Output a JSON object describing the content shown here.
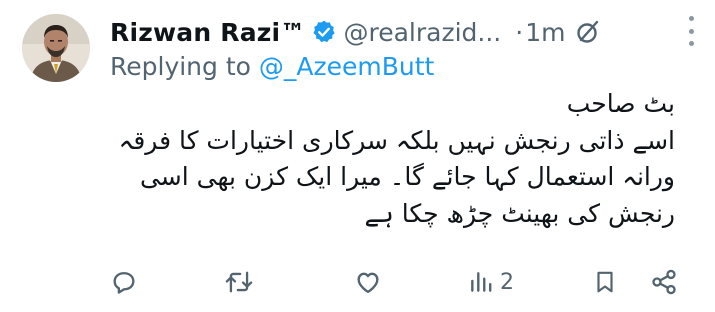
{
  "tweet": {
    "author_name": "Rizwan Razi™",
    "handle": "@realrazid...",
    "separator": "·",
    "time": "1m",
    "replying_to_label": "Replying to",
    "replying_to_handle": "@_AzeemButt",
    "lines": [
      "بٹ صاحب",
      "اسے ذاتی رنجش نہیں بلکہ سرکاری اختیارات کا فرقہ",
      "ورانہ استعمال کہا جائے گا۔ میرا ایک کزن بھی اسی",
      "رنجش کی بھینٹ چڑھ چکا ہے"
    ]
  },
  "actions": {
    "reply": {
      "icon": "reply-icon"
    },
    "retweet": {
      "icon": "retweet-icon"
    },
    "like": {
      "icon": "heart-icon"
    },
    "views": {
      "icon": "views-icon",
      "count": "2"
    },
    "bookmark": {
      "icon": "bookmark-icon"
    },
    "share": {
      "icon": "share-icon"
    }
  },
  "colors": {
    "link": "#1d9bf0",
    "muted": "#536471",
    "text": "#0f1419",
    "verified": "#1d9bf0"
  }
}
